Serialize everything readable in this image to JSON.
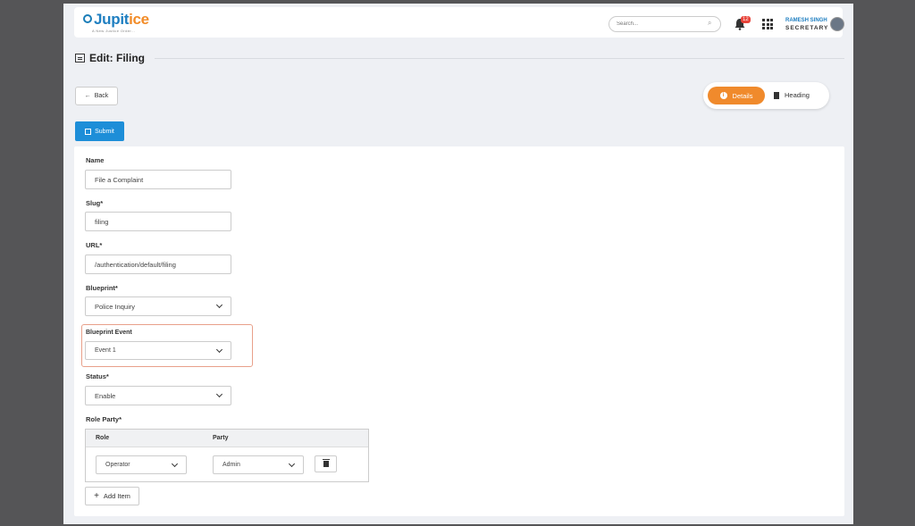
{
  "header": {
    "logo_text_main": "Jupit",
    "logo_text_accent": "ice",
    "logo_tagline": "A New Justice Order...",
    "search_placeholder": "Search...",
    "notification_count": "12",
    "user_name": "RAMESH SINGH",
    "user_role": "SECRETARY"
  },
  "page": {
    "title": "Edit: Filing",
    "back_label": "Back",
    "submit_label": "Submit",
    "tabs": [
      {
        "label": "Details",
        "active": true
      },
      {
        "label": "Heading",
        "active": false
      }
    ]
  },
  "form": {
    "name_label": "Name",
    "name_value": "File a Complaint",
    "slug_label": "Slug*",
    "slug_value": "filing",
    "url_label": "URL*",
    "url_value": "/authentication/default/filing",
    "blueprint_label": "Blueprint*",
    "blueprint_value": "Police Inquiry",
    "blueprint_event_label": "Blueprint Event",
    "blueprint_event_value": "Event 1",
    "status_label": "Status*",
    "status_value": "Enable",
    "role_party_label": "Role Party*",
    "role_party": {
      "col_role": "Role",
      "col_party": "Party",
      "rows": [
        {
          "role": "Operator",
          "party": "Admin"
        }
      ]
    },
    "add_item_label": "Add Item"
  },
  "colors": {
    "accent_orange": "#f08a2c",
    "primary_blue": "#1d8ed8",
    "highlight_border": "#e8a08a"
  }
}
